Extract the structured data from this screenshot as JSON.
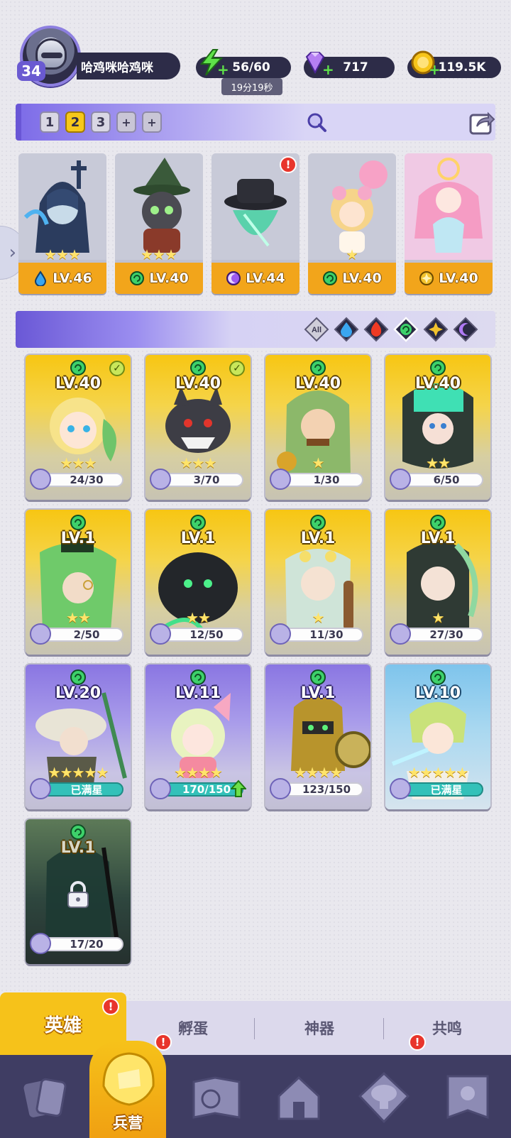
{
  "player": {
    "level": "34",
    "name": "哈鸡咪哈鸡咪"
  },
  "resources": {
    "energy": "56/60",
    "energy_timer": "19分19秒",
    "gems": "717",
    "gold": "119.5K"
  },
  "team_tabs": [
    "1",
    "2",
    "3",
    "+",
    "+"
  ],
  "team_active_index": 1,
  "lineup": [
    {
      "level": "LV.46",
      "stars": "★★★",
      "element": "water",
      "alert": false
    },
    {
      "level": "LV.40",
      "stars": "★★★",
      "element": "wind",
      "alert": false
    },
    {
      "level": "LV.44",
      "stars": "",
      "element": "dark",
      "alert": true
    },
    {
      "level": "LV.40",
      "stars": "★",
      "element": "wind",
      "alert": false
    },
    {
      "level": "LV.40",
      "stars": "",
      "element": "light",
      "alert": false
    }
  ],
  "filters": [
    "All",
    "water",
    "fire",
    "wind",
    "light",
    "dark"
  ],
  "filter_all_label": "All",
  "heroes": [
    {
      "level": "LV.40",
      "stars": "★★★",
      "progress": "24/30",
      "rarity": "gold",
      "deployed": true
    },
    {
      "level": "LV.40",
      "stars": "★★★",
      "progress": "3/70",
      "rarity": "gold",
      "deployed": true
    },
    {
      "level": "LV.40",
      "stars": "★",
      "progress": "1/30",
      "rarity": "gold",
      "deployed": false
    },
    {
      "level": "LV.40",
      "stars": "★★",
      "progress": "6/50",
      "rarity": "gold",
      "deployed": false
    },
    {
      "level": "LV.1",
      "stars": "★★",
      "progress": "2/50",
      "rarity": "gold",
      "deployed": false
    },
    {
      "level": "LV.1",
      "stars": "★★",
      "progress": "12/50",
      "rarity": "gold",
      "deployed": false
    },
    {
      "level": "LV.1",
      "stars": "★",
      "progress": "11/30",
      "rarity": "gold",
      "deployed": false
    },
    {
      "level": "LV.1",
      "stars": "★",
      "progress": "27/30",
      "rarity": "gold",
      "deployed": false
    },
    {
      "level": "LV.20",
      "stars": "★★★★★",
      "progress": "已满星",
      "rarity": "purple",
      "deployed": false
    },
    {
      "level": "LV.11",
      "stars": "★★★★",
      "progress": "170/150",
      "rarity": "purple",
      "deployed": false
    },
    {
      "level": "LV.1",
      "stars": "★★★★",
      "progress": "123/150",
      "rarity": "purple",
      "deployed": false
    },
    {
      "level": "LV.10",
      "stars": "★★★★★",
      "progress": "已满星",
      "rarity": "blue",
      "deployed": false
    },
    {
      "level": "LV.1",
      "stars": "",
      "progress": "17/20",
      "rarity": "dark",
      "deployed": false
    }
  ],
  "subtabs": [
    "英雄",
    "孵蛋",
    "神器",
    "共鸣"
  ],
  "nav": {
    "active_label": "兵营"
  },
  "colors": {
    "accent_gold": "#f6c21a",
    "accent_purple": "#6a58d6",
    "nav_bg": "#3f3d63",
    "alert_red": "#e8352c"
  }
}
